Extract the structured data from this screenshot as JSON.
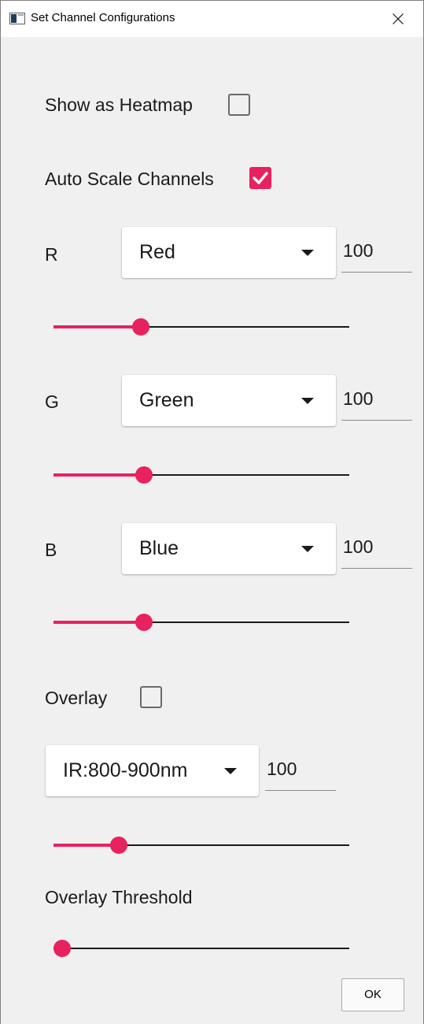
{
  "window": {
    "title": "Set Channel Configurations",
    "icon": "app-window-icon"
  },
  "heatmap": {
    "label": "Show as Heatmap",
    "checked": false
  },
  "auto_scale": {
    "label": "Auto Scale Channels",
    "checked": true
  },
  "channels": [
    {
      "label": "R",
      "selected": "Red",
      "value": "100",
      "slider_fraction": 0.295
    },
    {
      "label": "G",
      "selected": "Green",
      "value": "100",
      "slider_fraction": 0.306
    },
    {
      "label": "B",
      "selected": "Blue",
      "value": "100",
      "slider_fraction": 0.306
    }
  ],
  "overlay": {
    "label": "Overlay",
    "checked": false,
    "selected": "IR:800-900nm",
    "value": "100",
    "slider_fraction": 0.221
  },
  "overlay_threshold": {
    "label": "Overlay Threshold",
    "slider_fraction": 0.03
  },
  "ok_button": {
    "label": "OK"
  },
  "colors": {
    "accent": "#e8215f",
    "window_bg": "#f0f0f0",
    "titlebar_bg": "#ffffff"
  }
}
